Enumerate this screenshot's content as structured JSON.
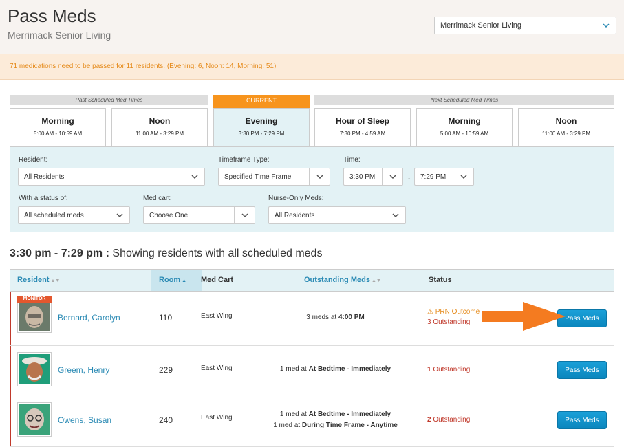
{
  "header": {
    "title": "Pass Meds",
    "subtitle": "Merrimack Senior Living",
    "facility_select": "Merrimack Senior Living"
  },
  "alert": {
    "text": "71 medications need to be passed for 11 residents. (Evening: 6, Noon: 14, Morning: 51)"
  },
  "time_slots": {
    "past_label": "Past Scheduled Med Times",
    "current_label": "CURRENT",
    "next_label": "Next Scheduled Med Times",
    "slots": [
      {
        "name": "Morning",
        "time": "5:00 AM - 10:59 AM"
      },
      {
        "name": "Noon",
        "time": "11:00 AM - 3:29 PM"
      },
      {
        "name": "Evening",
        "time": "3:30 PM - 7:29 PM"
      },
      {
        "name": "Hour of Sleep",
        "time": "7:30 PM - 4:59 AM"
      },
      {
        "name": "Morning",
        "time": "5:00 AM - 10:59 AM"
      },
      {
        "name": "Noon",
        "time": "11:00 AM - 3:29 PM"
      }
    ]
  },
  "filters": {
    "resident_label": "Resident:",
    "resident_value": "All Residents",
    "timeframe_label": "Timeframe Type:",
    "timeframe_value": "Specified Time Frame",
    "time_label": "Time:",
    "time_from": "3:30 PM",
    "time_separator": "-",
    "time_to": "7:29 PM",
    "status_label": "With a status of:",
    "status_value": "All scheduled meds",
    "medcart_label": "Med cart:",
    "medcart_value": "Choose One",
    "nurse_label": "Nurse-Only Meds:",
    "nurse_value": "All Residents"
  },
  "section": {
    "range": "3:30 pm - 7:29 pm :",
    "description": "Showing residents with all scheduled meds"
  },
  "table": {
    "columns": {
      "resident": "Resident",
      "room": "Room",
      "med_cart": "Med Cart",
      "outstanding": "Outstanding Meds",
      "status": "Status"
    },
    "monitor_badge": "MONITOR",
    "pass_label": "Pass Meds",
    "rows": [
      {
        "name": "Bernard, Carolyn",
        "room": "110",
        "cart": "East Wing",
        "meds": [
          {
            "prefix": "3 meds at ",
            "when": "4:00 PM"
          }
        ],
        "prn": "PRN Outcome",
        "outstanding_count": "3",
        "outstanding_word": "Outstanding"
      },
      {
        "name": "Greem, Henry",
        "room": "229",
        "cart": "East Wing",
        "meds": [
          {
            "prefix": "1 med at ",
            "when": "At Bedtime - Immediately"
          }
        ],
        "outstanding_count": "1",
        "outstanding_word": "Outstanding"
      },
      {
        "name": "Owens, Susan",
        "room": "240",
        "cart": "East Wing",
        "meds": [
          {
            "prefix": "1 med at ",
            "when": "At Bedtime - Immediately"
          },
          {
            "prefix": "1 med at ",
            "when": "During Time Frame - Anytime"
          }
        ],
        "outstanding_count": "2",
        "outstanding_word": "Outstanding"
      }
    ]
  },
  "colors": {
    "accent": "#f7941d",
    "link": "#2a8ab4",
    "danger": "#c0392b",
    "panel": "#e3f2f5",
    "button": "#0b86bd"
  }
}
